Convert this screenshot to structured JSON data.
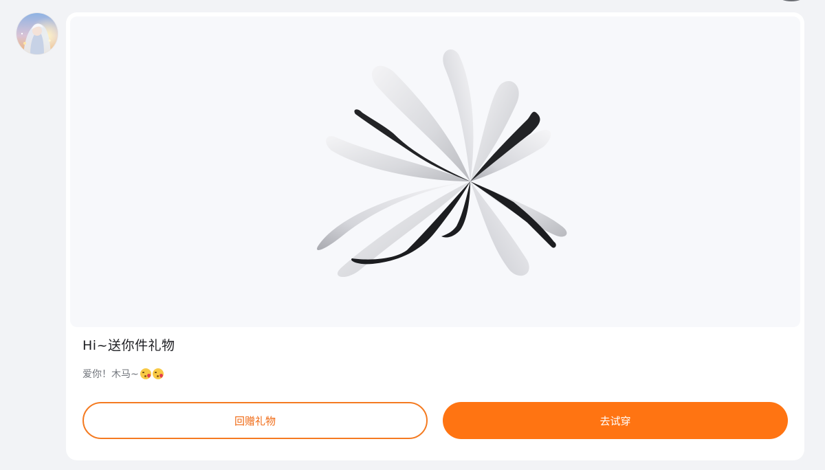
{
  "card": {
    "title": "Hi~送你件礼物",
    "message": "爱你！木马~",
    "message_emojis": [
      "kissing-heart-emoji",
      "kissing-heart-emoji"
    ],
    "image_icon": "white-spider-lily-flower"
  },
  "buttons": {
    "return_label": "回赠礼物",
    "try_on_label": "去试穿"
  },
  "colors": {
    "accent": "#ff7412",
    "outline": "#f47a20",
    "page_background": "#f2f3f6",
    "card_background": "#ffffff"
  }
}
